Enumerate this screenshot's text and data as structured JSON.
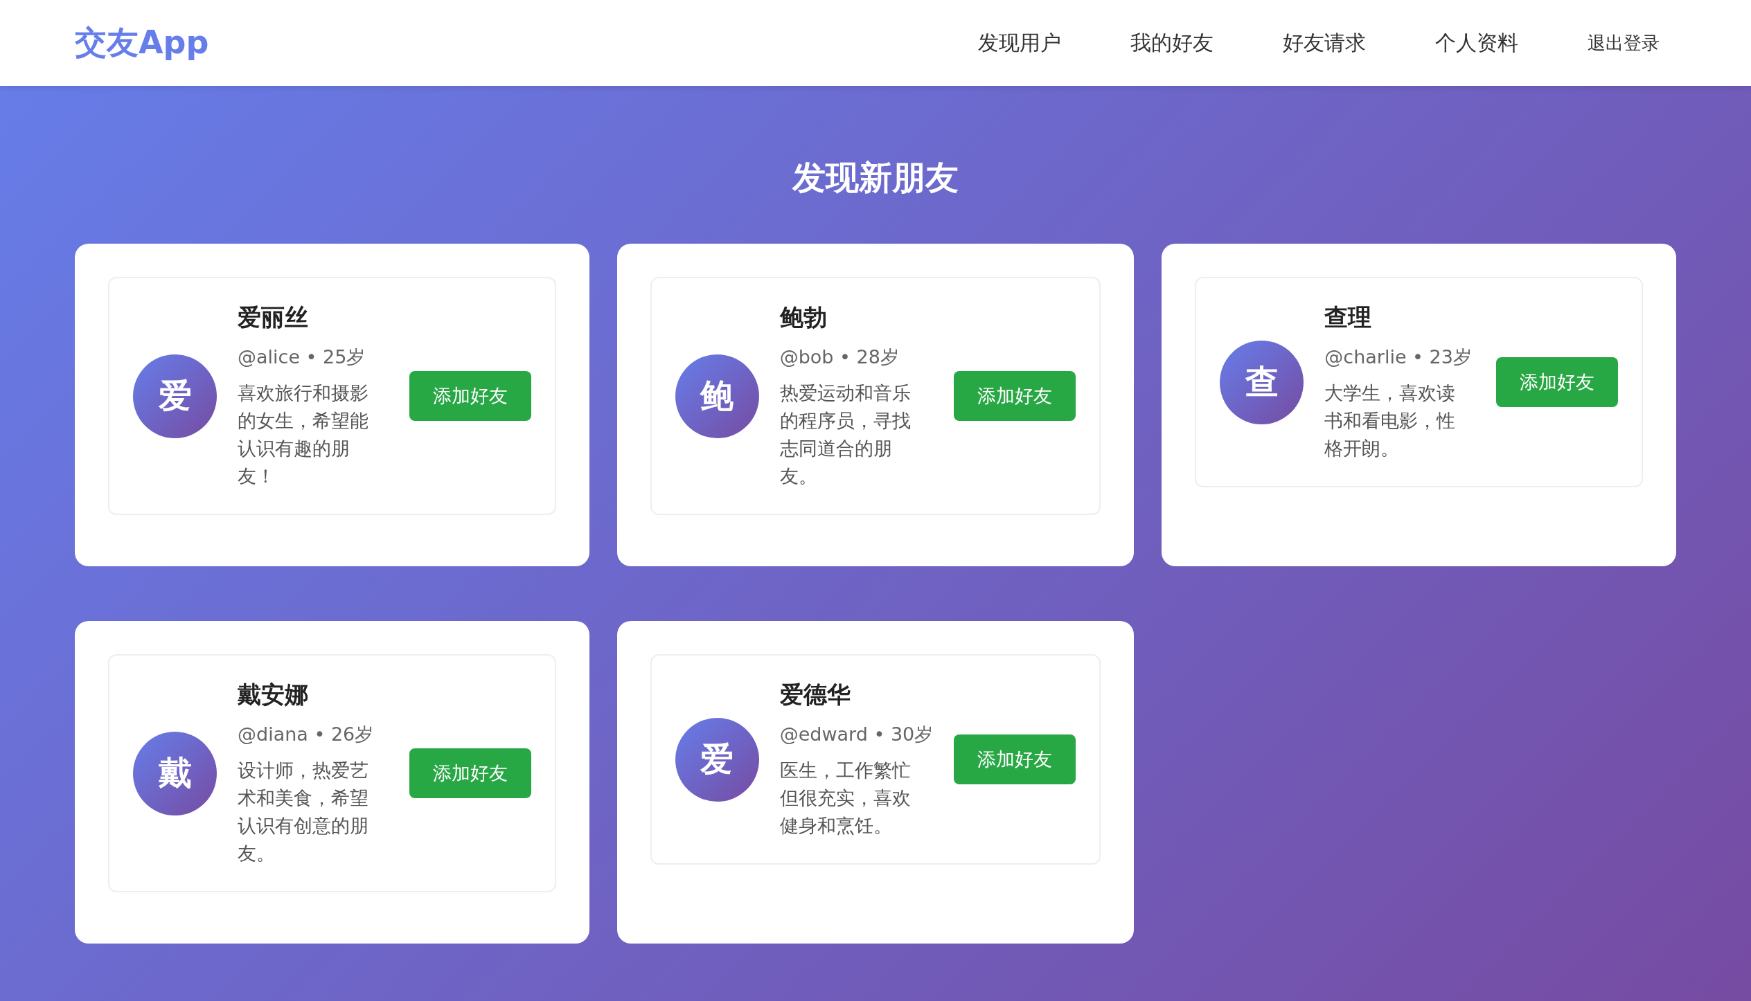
{
  "header": {
    "logo": "交友App",
    "nav": [
      {
        "label": "发现用户",
        "kind": "link"
      },
      {
        "label": "我的好友",
        "kind": "link"
      },
      {
        "label": "好友请求",
        "kind": "link"
      },
      {
        "label": "个人资料",
        "kind": "link"
      },
      {
        "label": "退出登录",
        "kind": "logout"
      }
    ]
  },
  "page_title": "发现新朋友",
  "users": [
    {
      "avatar": "爱",
      "name": "爱丽丝",
      "meta": "@alice • 25岁",
      "bio": "喜欢旅行和摄影的女生，希望能认识有趣的朋友！",
      "action": "添加好友"
    },
    {
      "avatar": "鲍",
      "name": "鲍勃",
      "meta": "@bob • 28岁",
      "bio": "热爱运动和音乐的程序员，寻找志同道合的朋友。",
      "action": "添加好友"
    },
    {
      "avatar": "查",
      "name": "查理",
      "meta": "@charlie • 23岁",
      "bio": "大学生，喜欢读书和看电影，性格开朗。",
      "action": "添加好友"
    },
    {
      "avatar": "戴",
      "name": "戴安娜",
      "meta": "@diana • 26岁",
      "bio": "设计师，热爱艺术和美食，希望认识有创意的朋友。",
      "action": "添加好友"
    },
    {
      "avatar": "爱",
      "name": "爱德华",
      "meta": "@edward • 30岁",
      "bio": "医生，工作繁忙但很充实，喜欢健身和烹饪。",
      "action": "添加好友"
    }
  ]
}
